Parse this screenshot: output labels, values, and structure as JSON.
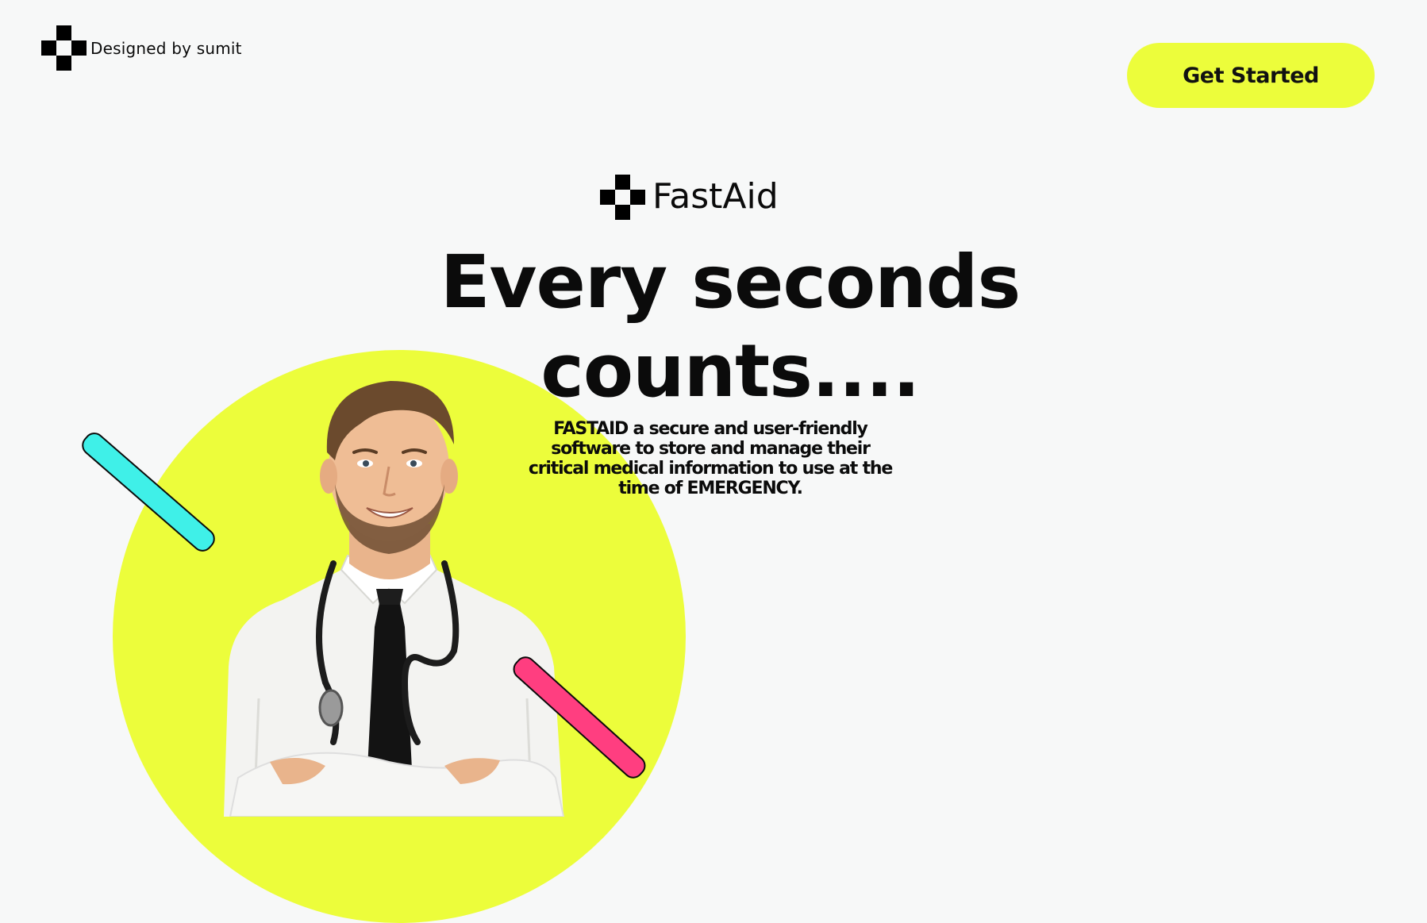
{
  "header": {
    "credit_text": "Designed by sumit",
    "cta_label": "Get Started"
  },
  "brand": {
    "name": "FastAid"
  },
  "hero": {
    "title_line1": "Every seconds",
    "title_line2": "counts....",
    "description": "FASTAID a secure and user-friendly software to store and manage their critical medical information to use at the time of EMERGENCY."
  },
  "colors": {
    "background": "#f7f8f8",
    "accent_yellow": "#ecfd3b",
    "accent_cyan": "#3ff0e8",
    "accent_pink": "#ff3e80"
  },
  "icons": {
    "logo": "medical-cross-checker-icon"
  }
}
